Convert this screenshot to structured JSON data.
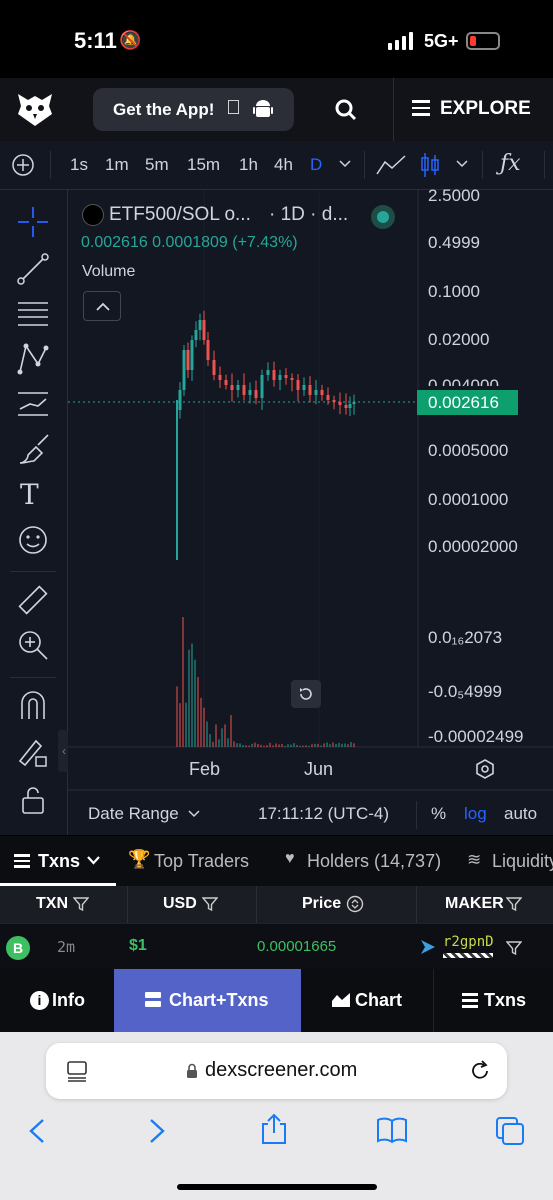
{
  "status": {
    "time": "5:11",
    "network": "5G+"
  },
  "header": {
    "get_app": "Get the App!",
    "explore": "EXPLORE"
  },
  "toolbar": {
    "intervals": [
      "1s",
      "1m",
      "5m",
      "15m",
      "1h",
      "4h",
      "D"
    ],
    "fx": "ƒx"
  },
  "chart": {
    "legend_title": "ETF500/SOL o...",
    "legend_interval": "· 1D · d...",
    "ohlc_values": "0.002616  0.0001809 (+7.43%)",
    "volume_label": "Volume",
    "price_label": "0.002616",
    "y_ticks": [
      "2.5000",
      "0.4999",
      "0.1000",
      "0.02000",
      "0.004000",
      "0.0005000",
      "0.0001000",
      "0.00002000"
    ],
    "vol_ticks": [
      "0.0₁₆2073",
      "-0.0₅4999",
      "-0.00002499"
    ],
    "x_ticks": [
      "Feb",
      "Jun"
    ],
    "date_range": "Date Range",
    "time": "17:11:12 (UTC-4)",
    "pct": "%",
    "log": "log",
    "auto": "auto",
    "colors": {
      "up": "#26a69a",
      "down": "#ef5350",
      "price_tag": "#0e9f6e"
    }
  },
  "tabs": [
    "Txns",
    "Top Traders",
    "Holders (14,737)",
    "Liquidity"
  ],
  "table": {
    "headers": [
      "TXN",
      "USD",
      "Price",
      "MAKER"
    ],
    "row": {
      "type": "B",
      "age": "2m",
      "usd": "$1",
      "price": "0.00001665",
      "maker": "r2gpnD"
    }
  },
  "bottom_nav": [
    "Info",
    "Chart+Txns",
    "Chart",
    "Txns"
  ],
  "safari": {
    "url": "dexscreener.com"
  }
}
